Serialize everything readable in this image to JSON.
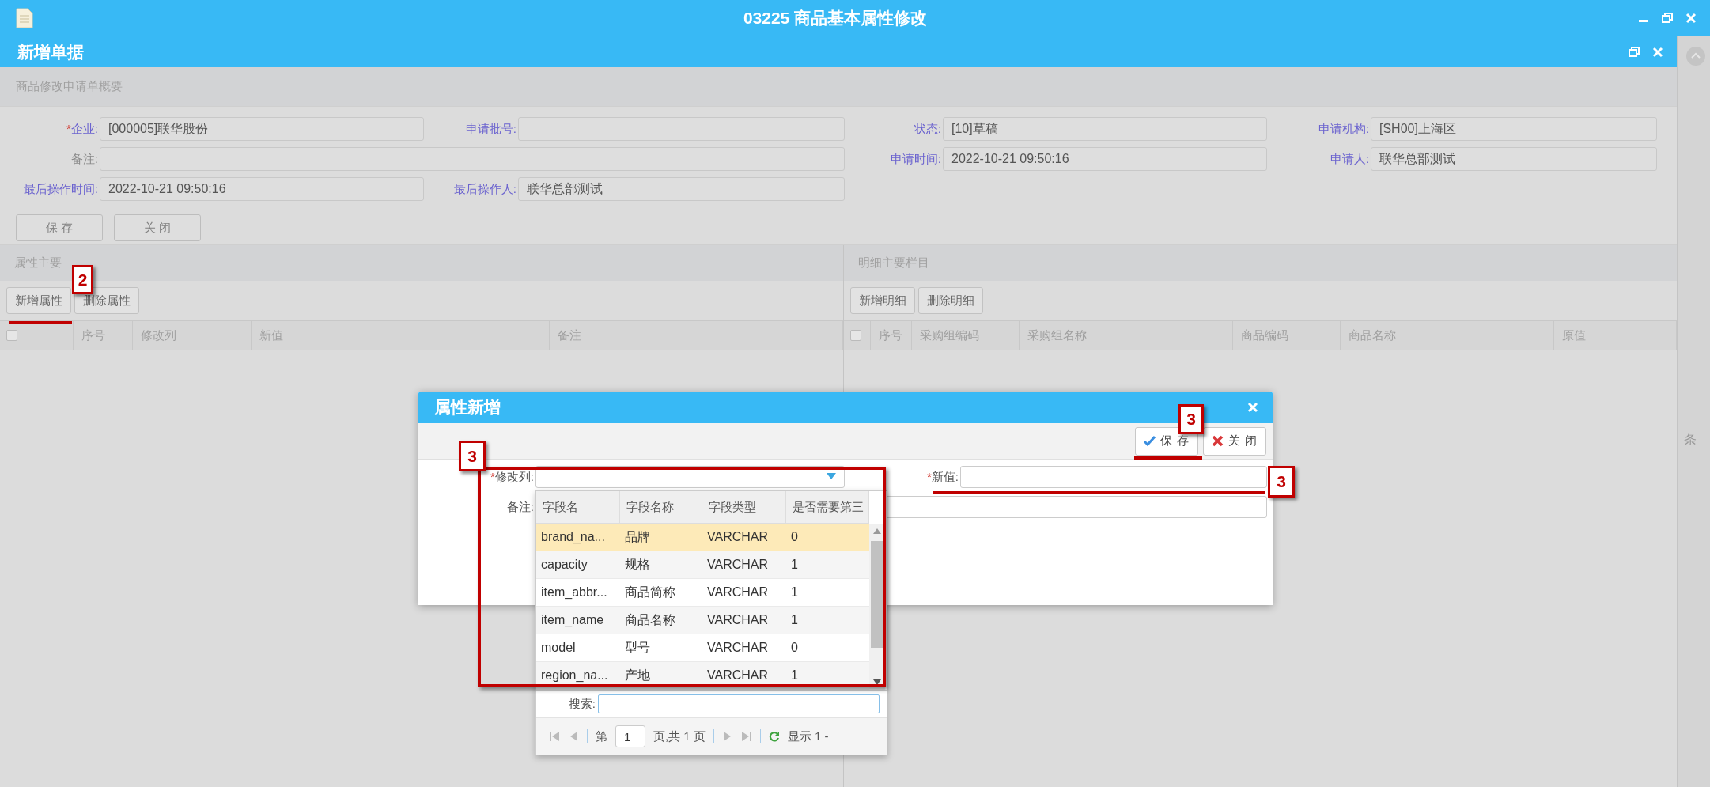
{
  "window": {
    "title": "03225 商品基本属性修改"
  },
  "document": {
    "title": "新增单据"
  },
  "summary": {
    "title": "商品修改申请单概要",
    "fields": [
      {
        "mark": "*",
        "label": "企业:",
        "value": "[000005]联华股份",
        "highlighted": true
      },
      {
        "label": "申请批号:",
        "highlighted": true
      },
      {
        "label": "状态:",
        "value": "[10]草稿",
        "highlighted": true
      },
      {
        "label": "申请机构:",
        "value": "[SH00]上海区",
        "highlighted": true
      },
      {
        "label": "备注:",
        "highlighted": false,
        "wide": true
      },
      {
        "label": "申请时间:",
        "value": "2022-10-21 09:50:16",
        "highlighted": true
      },
      {
        "label": "申请人:",
        "value": "联华总部测试",
        "highlighted": true
      },
      {
        "label": "最后操作时间:",
        "value": "2022-10-21 09:50:16",
        "highlighted": true
      },
      {
        "label": "最后操作人:",
        "value": "联华总部测试",
        "highlighted": true
      }
    ],
    "buttons": [
      "保 存",
      "关 闭"
    ]
  },
  "attributes": {
    "title": "属性主要",
    "buttons": [
      "新增属性",
      "删除属性"
    ],
    "select_all_checked": false,
    "columns": [
      "序号",
      "修改列",
      "新值",
      "备注"
    ]
  },
  "details": {
    "title": "明细主要栏目",
    "buttons": [
      "新增明细",
      "删除明细"
    ],
    "select_all_checked": false,
    "columns": [
      "序号",
      "采购组编码",
      "采购组名称",
      "商品编码",
      "商品名称",
      "原值"
    ]
  },
  "side_strip": {
    "text": "条"
  },
  "dialog": {
    "title": "属性新增",
    "buttons": [
      {
        "label": "保 存",
        "kind": "save"
      },
      {
        "label": "关 闭",
        "kind": "close"
      }
    ],
    "fields": [
      {
        "mark": "*",
        "label": "修改列:",
        "kind": "combo"
      },
      {
        "mark": "*",
        "label": "新值:",
        "kind": "text"
      },
      {
        "label": "备注:",
        "kind": "text",
        "wide": true
      }
    ]
  },
  "column_picker": {
    "columns": [
      "字段名",
      "字段名称",
      "字段类型",
      "是否需要第三"
    ],
    "rows": [
      {
        "cells": [
          "brand_na...",
          "品牌",
          "VARCHAR",
          "0"
        ],
        "selected": true
      },
      {
        "cells": [
          "capacity",
          "规格",
          "VARCHAR",
          "1"
        ],
        "selected": false
      },
      {
        "cells": [
          "item_abbr...",
          "商品简称",
          "VARCHAR",
          "1"
        ],
        "selected": false
      },
      {
        "cells": [
          "item_name",
          "商品名称",
          "VARCHAR",
          "1"
        ],
        "selected": false
      },
      {
        "cells": [
          "model",
          "型号",
          "VARCHAR",
          "0"
        ],
        "selected": false
      },
      {
        "cells": [
          "region_na...",
          "产地",
          "VARCHAR",
          "1"
        ],
        "selected": false
      }
    ],
    "search_label": "搜索:",
    "pager": {
      "page_prefix": "第",
      "page": "1",
      "page_suffix": "页,共 1 页",
      "summary": "显示 1 -"
    }
  },
  "annotations": [
    {
      "kind": "callout",
      "label": "2"
    },
    {
      "kind": "underline"
    },
    {
      "kind": "frame"
    },
    {
      "kind": "callout",
      "label": "3"
    },
    {
      "kind": "callout",
      "label": "3"
    },
    {
      "kind": "underline"
    },
    {
      "kind": "callout",
      "label": "3"
    },
    {
      "kind": "underline"
    }
  ]
}
